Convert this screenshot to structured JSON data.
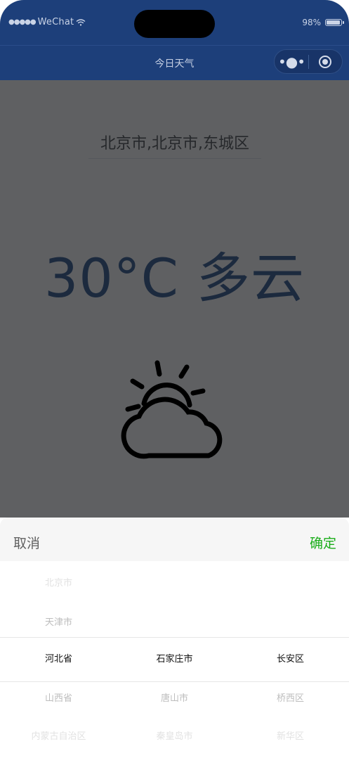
{
  "status_bar": {
    "carrier": "WeChat",
    "battery": "98%"
  },
  "nav": {
    "title": "今日天气"
  },
  "location": {
    "value": "北京市,北京市,东城区"
  },
  "weather": {
    "summary": "30°C 多云",
    "icon": "partly-cloudy-icon"
  },
  "sheet": {
    "cancel_label": "取消",
    "confirm_label": "确定"
  },
  "picker": {
    "provinces": [
      "北京市",
      "天津市",
      "河北省",
      "山西省",
      "内蒙古自治区"
    ],
    "cities": [
      "",
      "",
      "石家庄市",
      "唐山市",
      "秦皇岛市"
    ],
    "districts": [
      "",
      "",
      "长安区",
      "桥西区",
      "新华区"
    ],
    "selected_index": 2
  },
  "colors": {
    "nav_bg": "#1d3f7a",
    "confirm": "#1aad19",
    "overlay": "#5f6062"
  }
}
